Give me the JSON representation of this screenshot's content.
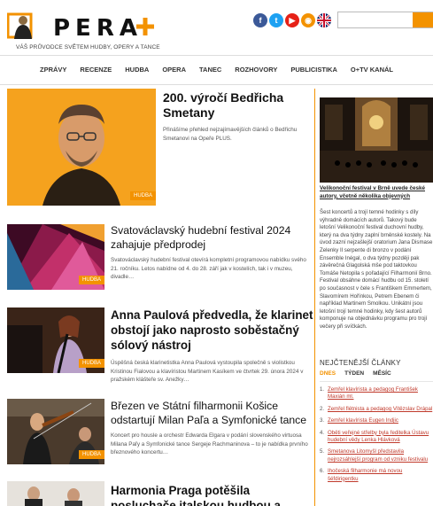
{
  "header": {
    "logo_text": "PERA",
    "logo_tagline": "VÁŠ PRŮVODCE SVĚTEM HUDBY, OPERY A TANCE",
    "social": [
      {
        "icon": "facebook-icon",
        "color": "#3b5998",
        "glyph": "f"
      },
      {
        "icon": "twitter-icon",
        "color": "#1da1f2",
        "glyph": "t"
      },
      {
        "icon": "youtube-icon",
        "color": "#e62117",
        "glyph": "▶"
      },
      {
        "icon": "rss-icon",
        "color": "#f39200",
        "glyph": "◉"
      },
      {
        "icon": "uk-flag-icon",
        "color": "#012169",
        "glyph": ""
      }
    ],
    "search_placeholder": ""
  },
  "nav": {
    "items": [
      "ZPRÁVY",
      "RECENZE",
      "HUDBA",
      "OPERA",
      "TANEC",
      "ROZHOVORY",
      "PUBLICISTIKA",
      "O+TV KANÁL"
    ]
  },
  "articles": [
    {
      "title": "200. výročí Bedřicha Smetany",
      "text": "Přinášíme přehled nejzajímavějších článků o Bedřichu Smetanovi na Opeře PLUS.",
      "badge": "HUDBA"
    },
    {
      "title": "Svatováclavský hudební festival 2024 zahajuje předprodej",
      "text": "Svatováclavský hudební festival otevírá kompletní programovou nabídku svého 21. ročníku. Letos nabídne od 4. do 28. září jak v kostelích, tak i v muzeu, divadle…",
      "badge": "HUDBA"
    },
    {
      "title": "Anna Paulová předvedla, že klarinet obstojí jako naprosto soběstačný sólový nástroj",
      "text": "Úspěšná česká klarinetistka Anna Paulová vystoupila společně s violistkou Kristinou Fialovou a klavíristou Martinem Kasíkem ve čtvrtek 29. února 2024 v pražském klášteře sv. Anežky…",
      "badge": "HUDBA"
    },
    {
      "title": "Březen ve Státní filharmonii Košice odstartují Milan Paľa a Symfonické tance",
      "text": "Koncert pro housle a orchestr Edwarda Elgara v podání slovenského virtuosa Milana Paľy a Symfonické tance Sergeje Rachmaninova – to je nabídka prvního březnového koncertu…",
      "badge": "HUDBA"
    },
    {
      "title": "Harmonia Praga potěšila posluchače italskou hudbou a témy…",
      "text": "",
      "badge": ""
    }
  ],
  "sidebar": {
    "feature_caption": "Velikonoční festival v Brně uvede české autory, včetně několika objevných",
    "feature_text": "Šest koncertů a trojí temné hodinky s díly výhradně domácích autorů. Takový bude letošní Velikonoční festival duchovní hudby, který na dva týdny zaplní brněnské kostely. Na úvod zazní nejzašlejší oratorium Jana Dismase Zelenky Il serpente di bronzo v podání Ensemble Inégal, o dva týdny později pak závěrečná Glagolská mše pod taktovkou Tomáše Netopila s pořadající Filharmonií Brno. Festival obsáhne domácí hudbu od 15. století po současnost v čele s Františkem Emmertem, Slavomírem Hořínkou, Petrem Ebenem či například Martinem Smolkou. Unikátní jsou letošní trojí temné hodinky, kdy šest autorů komponuje na objednávku programu pro trojí večery při svíčkách.",
    "popular_title": "NEJČTENĚJŠÍ ČLÁNKY",
    "tabs": [
      "DNES",
      "TÝDEN",
      "MĚSÍC"
    ],
    "popular": [
      "Zemřel klavírista a pedagog František Maxián ml.",
      "Zemřel flétnista a pedagog Vítězslav Drápal",
      "Zemřel klavírista Eugen Indjic",
      "Oběti veřejné střelby byla ředitelka Ústavu hudební vědy Lenka Hlávková",
      "Smetanova Litomyšl představila nejrozsáhlejší program od vzniku festivalu",
      "Ihočeská filharmonie má novou šéfdirigentku"
    ]
  },
  "colors": {
    "accent": "#f39200",
    "link": "#c0392b"
  }
}
